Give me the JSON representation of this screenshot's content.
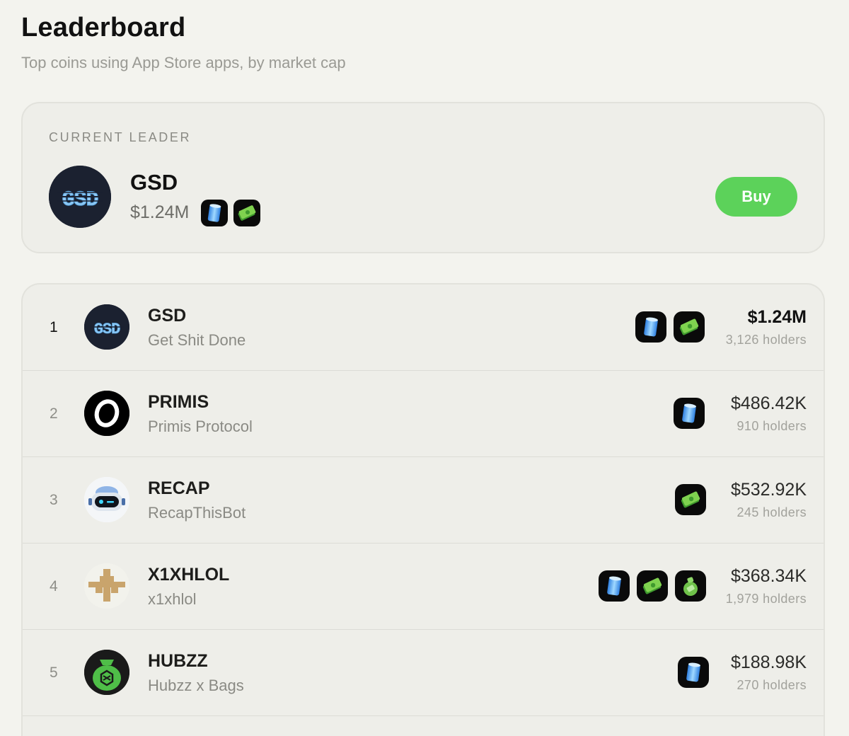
{
  "header": {
    "title": "Leaderboard",
    "subtitle": "Top coins using App Store apps, by market cap"
  },
  "leader": {
    "eyebrow": "CURRENT LEADER",
    "symbol": "GSD",
    "avatar_text": "GSD",
    "market_cap": "$1.24M",
    "apps": [
      "juice-can-app-icon",
      "cash-stack-app-icon"
    ],
    "buy_label": "Buy"
  },
  "colors": {
    "background": "#f3f3ee",
    "card": "#eeeee9",
    "buy_button": "#5cd25a",
    "muted_text": "#8a8a84"
  },
  "rows": [
    {
      "rank": "1",
      "symbol": "GSD",
      "name": "Get Shit Done",
      "avatar": "gsd-logo",
      "avatar_text": "GSD",
      "apps": [
        "juice-can-app-icon",
        "cash-stack-app-icon"
      ],
      "market_cap": "$1.24M",
      "holders": "3,126 holders"
    },
    {
      "rank": "2",
      "symbol": "PRIMIS",
      "name": "Primis Protocol",
      "avatar": "primis-logo",
      "apps": [
        "juice-can-app-icon"
      ],
      "market_cap": "$486.42K",
      "holders": "910 holders"
    },
    {
      "rank": "3",
      "symbol": "RECAP",
      "name": "RecapThisBot",
      "avatar": "robot-logo",
      "apps": [
        "cash-stack-app-icon"
      ],
      "market_cap": "$532.92K",
      "holders": "245 holders"
    },
    {
      "rank": "4",
      "symbol": "X1XHLOL",
      "name": "x1xhlol",
      "avatar": "pixel-cross-logo",
      "apps": [
        "juice-can-app-icon",
        "cash-stack-app-icon",
        "money-bag-app-icon"
      ],
      "market_cap": "$368.34K",
      "holders": "1,979 holders"
    },
    {
      "rank": "5",
      "symbol": "HUBZZ",
      "name": "Hubzz x Bags",
      "avatar": "money-bag-logo",
      "apps": [
        "juice-can-app-icon"
      ],
      "market_cap": "$188.98K",
      "holders": "270 holders"
    }
  ]
}
